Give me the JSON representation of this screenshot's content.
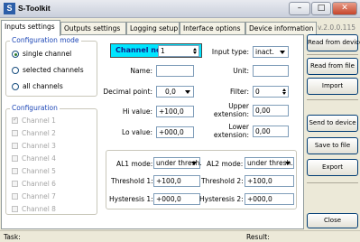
{
  "app": {
    "logo_letter": "S",
    "title": "S-Toolkit",
    "version": "v.2.0.0.115"
  },
  "window_buttons": {
    "minimize": "–",
    "maximize": "□",
    "close": "✕"
  },
  "tabs": [
    {
      "label": "Inputs settings",
      "active": true
    },
    {
      "label": "Outputs settings",
      "active": false
    },
    {
      "label": "Logging setup",
      "active": false
    },
    {
      "label": "Interface options",
      "active": false
    },
    {
      "label": "Device information",
      "active": false
    }
  ],
  "config_mode": {
    "title": "Configuration mode",
    "options": [
      {
        "label": "single channel",
        "selected": true
      },
      {
        "label": "selected channels",
        "selected": false
      },
      {
        "label": "all channels",
        "selected": false
      }
    ]
  },
  "configuration": {
    "title": "Configuration",
    "channels": [
      {
        "label": "Channel 1",
        "checked": true
      },
      {
        "label": "Channel 2",
        "checked": false
      },
      {
        "label": "Channel 3",
        "checked": false
      },
      {
        "label": "Channel 4",
        "checked": false
      },
      {
        "label": "Channel 5",
        "checked": false
      },
      {
        "label": "Channel 6",
        "checked": false
      },
      {
        "label": "Channel 7",
        "checked": false
      },
      {
        "label": "Channel 8",
        "checked": false
      }
    ]
  },
  "form": {
    "channel_label": "Channel no:",
    "channel_value": "1",
    "input_type_label": "Input type:",
    "input_type_value": "inact.",
    "name_label": "Name:",
    "name_value": "",
    "unit_label": "Unit:",
    "unit_value": "",
    "decimal_label": "Decimal point:",
    "decimal_value": "0,0",
    "filter_label": "Filter:",
    "filter_value": "0",
    "hi_label": "Hi value:",
    "hi_value": "+100,0",
    "upper_ext_label_1": "Upper",
    "upper_ext_label_2": "extension:",
    "upper_ext_value": "0,00",
    "lo_label": "Lo value:",
    "lo_value": "+000,0",
    "lower_ext_label_1": "Lower",
    "lower_ext_label_2": "extension:",
    "lower_ext_value": "0,00"
  },
  "alarms": {
    "al1_mode_label": "AL1 mode:",
    "al1_mode_value": "under thresh.",
    "al2_mode_label": "AL2 mode:",
    "al2_mode_value": "under thresh.",
    "threshold1_label": "Threshold 1:",
    "threshold1_value": "+100,0",
    "threshold2_label": "Threshold 2:",
    "threshold2_value": "+100,0",
    "hysteresis1_label": "Hysteresis 1:",
    "hysteresis1_value": "+000,0",
    "hysteresis2_label": "Hysteresis 2:",
    "hysteresis2_value": "+000,0"
  },
  "side_buttons": {
    "read_device": "Read from device",
    "read_file": "Read from file",
    "import": "Import",
    "send_device": "Send to device",
    "save_file": "Save to file",
    "export": "Export",
    "close": "Close"
  },
  "status": {
    "task_label": "Task:",
    "result_label": "Result:"
  },
  "colors": {
    "highlight": "#00e5ff",
    "group_title": "#1c46b6",
    "disabled_text": "#a5a5a5"
  }
}
